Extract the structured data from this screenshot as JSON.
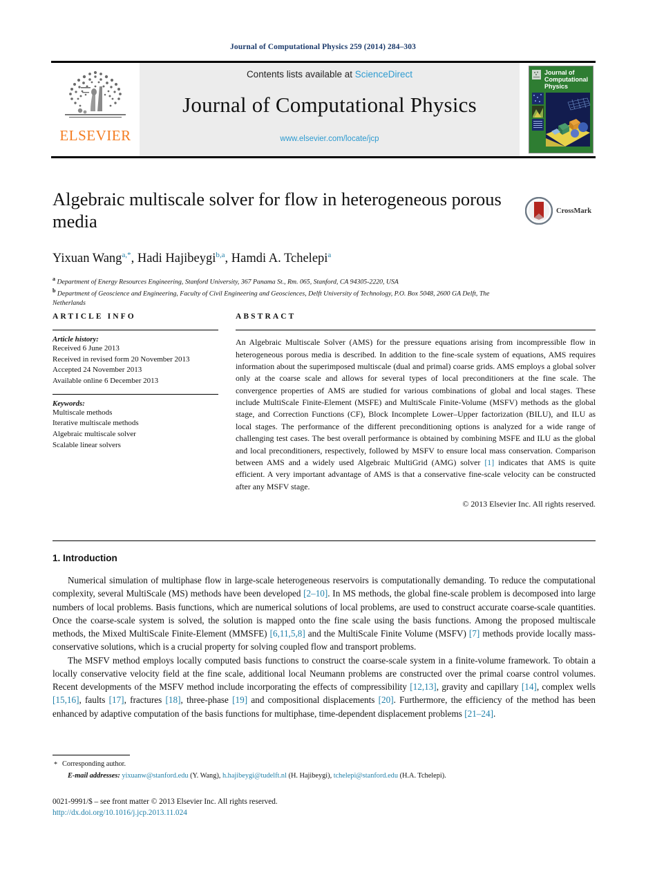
{
  "running_head": "Journal of Computational Physics 259 (2014) 284–303",
  "masthead": {
    "contents_prefix": "Contents lists available at ",
    "sciencedirect": "ScienceDirect",
    "journal_title": "Journal of Computational Physics",
    "journal_url": "www.elsevier.com/locate/jcp",
    "publisher_wordmark": "ELSEVIER",
    "publisher_logo_icon": "elsevier-tree-icon",
    "cover_title_lines": [
      "Journal of",
      "Computational",
      "Physics"
    ],
    "cover_bg_color": "#2e7d32",
    "accent_link_color": "#2e9bd0"
  },
  "article": {
    "title": "Algebraic multiscale solver for flow in heterogeneous porous media",
    "crossmark_label": "CrossMark",
    "authors": [
      {
        "name": "Yixuan Wang",
        "marks": "a,*"
      },
      {
        "name": "Hadi Hajibeygi",
        "marks": "b,a"
      },
      {
        "name": "Hamdi A. Tchelepi",
        "marks": "a"
      }
    ],
    "affiliations": [
      {
        "mark": "a",
        "text": "Department of Energy Resources Engineering, Stanford University, 367 Panama St., Rm. 065, Stanford, CA 94305-2220, USA"
      },
      {
        "mark": "b",
        "text": "Department of Geoscience and Engineering, Faculty of Civil Engineering and Geosciences, Delft University of Technology, P.O. Box 5048, 2600 GA Delft, The Netherlands"
      }
    ]
  },
  "article_info": {
    "heading": "ARTICLE INFO",
    "history_label": "Article history:",
    "history": [
      "Received 6 June 2013",
      "Received in revised form 20 November 2013",
      "Accepted 24 November 2013",
      "Available online 6 December 2013"
    ],
    "keywords_label": "Keywords:",
    "keywords": [
      "Multiscale methods",
      "Iterative multiscale methods",
      "Algebraic multiscale solver",
      "Scalable linear solvers"
    ]
  },
  "abstract": {
    "heading": "ABSTRACT",
    "part1": "An Algebraic Multiscale Solver (AMS) for the pressure equations arising from incompressible flow in heterogeneous porous media is described. In addition to the fine-scale system of equations, AMS requires information about the superimposed multiscale (dual and primal) coarse grids. AMS employs a global solver only at the coarse scale and allows for several types of local preconditioners at the fine scale. The convergence properties of AMS are studied for various combinations of global and local stages. These include MultiScale Finite-Element (MSFE) and MultiScale Finite-Volume (MSFV) methods as the global stage, and Correction Functions (CF), Block Incomplete Lower–Upper factorization (BILU), and ILU as local stages. The performance of the different preconditioning options is analyzed for a wide range of challenging test cases. The best overall performance is obtained by combining MSFE and ILU as the global and local preconditioners, respectively, followed by MSFV to ensure local mass conservation. Comparison between AMS and a widely used Algebraic MultiGrid (AMG) solver ",
    "ref1": "[1]",
    "part2": " indicates that AMS is quite efficient. A very important advantage of AMS is that a conservative fine-scale velocity can be constructed after any MSFV stage.",
    "copyright": "© 2013 Elsevier Inc. All rights reserved."
  },
  "body": {
    "section_number_title": "1. Introduction",
    "p1_a": "Numerical simulation of multiphase flow in large-scale heterogeneous reservoirs is computationally demanding. To reduce the computational complexity, several MultiScale (MS) methods have been developed ",
    "p1_ref1": "[2–10]",
    "p1_b": ". In MS methods, the global fine-scale problem is decomposed into large numbers of local problems. Basis functions, which are numerical solutions of local problems, are used to construct accurate coarse-scale quantities. Once the coarse-scale system is solved, the solution is mapped onto the fine scale using the basis functions. Among the proposed multiscale methods, the Mixed MultiScale Finite-Element (MMSFE) ",
    "p1_ref2": "[6,11,5,8]",
    "p1_c": " and the MultiScale Finite Volume (MSFV) ",
    "p1_ref3": "[7]",
    "p1_d": " methods provide locally mass-conservative solutions, which is a crucial property for solving coupled flow and transport problems.",
    "p2_a": "The MSFV method employs locally computed basis functions to construct the coarse-scale system in a finite-volume framework. To obtain a locally conservative velocity field at the fine scale, additional local Neumann problems are constructed over the primal coarse control volumes. Recent developments of the MSFV method include incorporating the effects of compressibility ",
    "p2_ref1": "[12,13]",
    "p2_b": ", gravity and capillary ",
    "p2_ref2": "[14]",
    "p2_c": ", complex wells ",
    "p2_ref3": "[15,16]",
    "p2_d": ", faults ",
    "p2_ref4": "[17]",
    "p2_e": ", fractures ",
    "p2_ref5": "[18]",
    "p2_f": ", three-phase ",
    "p2_ref6": "[19]",
    "p2_g": " and compositional displacements ",
    "p2_ref7": "[20]",
    "p2_h": ". Furthermore, the efficiency of the method has been enhanced by adaptive computation of the basis functions for multiphase, time-dependent displacement problems ",
    "p2_ref8": "[21–24]",
    "p2_i": "."
  },
  "footnote": {
    "corresponding": "Corresponding author.",
    "email_label": "E-mail addresses:",
    "emails": [
      {
        "address": "yixuanw@stanford.edu",
        "owner": "(Y. Wang)"
      },
      {
        "address": "h.hajibeygi@tudelft.nl",
        "owner": "(H. Hajibeygi)"
      },
      {
        "address": "tchelepi@stanford.edu",
        "owner": "(H.A. Tchelepi)"
      }
    ]
  },
  "imprint": {
    "issn_line": "0021-9991/$ – see front matter © 2013 Elsevier Inc. All rights reserved.",
    "doi": "http://dx.doi.org/10.1016/j.jcp.2013.11.024"
  }
}
